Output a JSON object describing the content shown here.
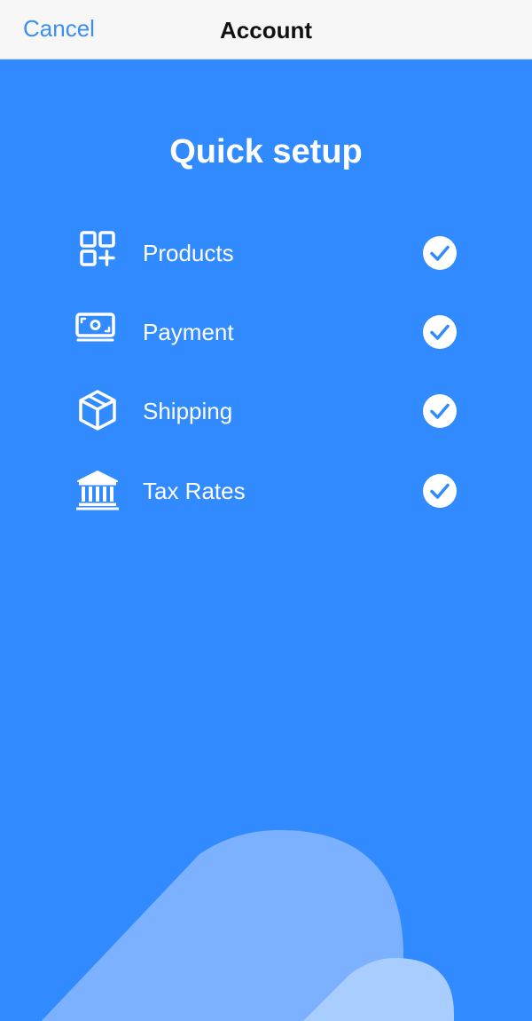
{
  "nav": {
    "cancel_label": "Cancel",
    "title": "Account"
  },
  "main": {
    "heading": "Quick setup",
    "items": [
      {
        "label": "Products",
        "icon": "products-grid-add-icon",
        "checked": true
      },
      {
        "label": "Payment",
        "icon": "banknote-icon",
        "checked": true
      },
      {
        "label": "Shipping",
        "icon": "package-box-icon",
        "checked": true
      },
      {
        "label": "Tax Rates",
        "icon": "bank-building-icon",
        "checked": true
      }
    ]
  },
  "colors": {
    "background": "#318bff",
    "nav_background": "#f7f7f7",
    "accent": "#3a8ff0",
    "text_on_blue": "#ffffff",
    "check_mark": "#318bff",
    "blob_light": "#7cb1ff",
    "blob_lighter": "#aacdff"
  }
}
